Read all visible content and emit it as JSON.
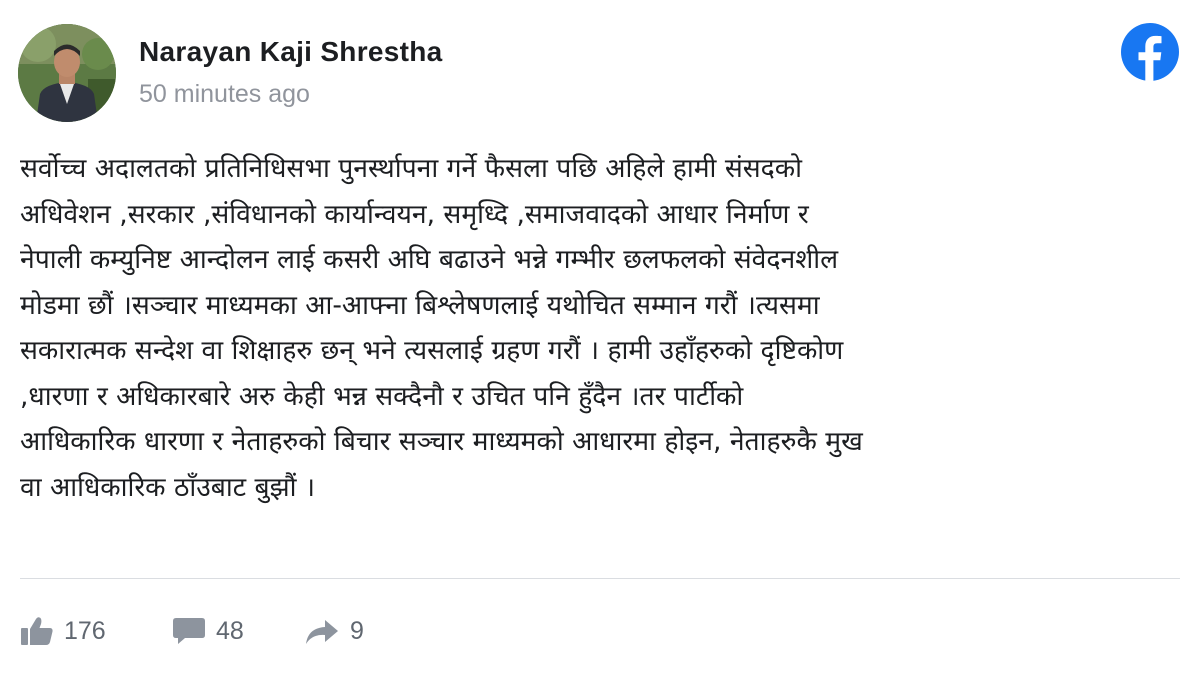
{
  "post": {
    "author": "Narayan Kaji Shrestha",
    "timestamp": "50 minutes ago",
    "lines": [
      "सर्वोच्च अदालतको प्रतिनिधिसभा पुनर्स्थापना गर्ने फैसला पछि अहिले हामी संसदको",
      "अधिवेशन ,सरकार ,संविधानको कार्यान्वयन, समृध्दि ,समाजवादको आधार निर्माण र",
      "नेपाली कम्युनिष्ट आन्दोलन लाई कसरी अघि बढाउने भन्ने गम्भीर छलफलको संवेदनशील",
      "मोडमा छौं ।सञ्चार माध्यमका आ-आफ्ना बिश्लेषणलाई यथोचित सम्मान गरौं ।त्यसमा",
      "सकारात्मक सन्देश वा शिक्षाहरु छन् भने त्यसलाई ग्रहण गरौं । हामी उहाँहरुको दृष्टिकोण",
      ",धारणा र अधिकारबारे अरु केही भन्न सक्दैनौ र उचित पनि हुँदैन ।तर पार्टीको",
      "आधिकारिक धारणा र नेताहरुको बिचार सञ्चार माध्यमको आधारमा होइन, नेताहरुकै मुख",
      "वा आधिकारिक ठाँउबाट बुझौं ।"
    ]
  },
  "stats": {
    "likes": "176",
    "comments": "48",
    "shares": "9"
  },
  "icons": {
    "brand": "facebook-logo-icon",
    "like": "thumbs-up-icon",
    "comment": "comment-bubble-icon",
    "share": "share-arrow-icon"
  },
  "colors": {
    "facebook_blue": "#1877f2",
    "author_text": "#1c1e21",
    "secondary_text": "#90949c",
    "stat_icon": "#8d949e"
  }
}
